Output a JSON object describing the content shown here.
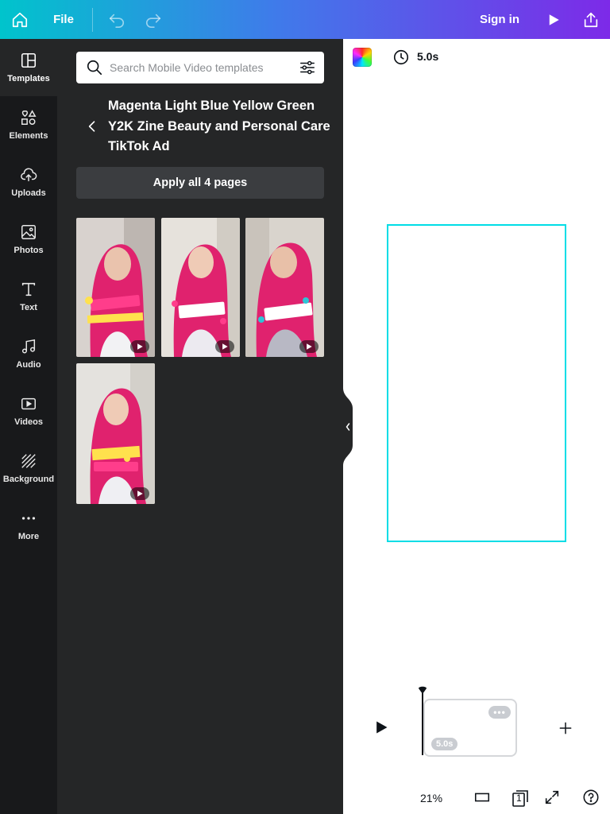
{
  "topbar": {
    "file_label": "File",
    "signin_label": "Sign in",
    "icons": [
      "home-icon",
      "undo-icon",
      "redo-icon",
      "play-icon",
      "share-icon"
    ]
  },
  "rail": {
    "items": [
      {
        "label": "Templates",
        "icon": "templates-icon"
      },
      {
        "label": "Elements",
        "icon": "elements-icon"
      },
      {
        "label": "Uploads",
        "icon": "upload-cloud-icon"
      },
      {
        "label": "Photos",
        "icon": "photo-icon"
      },
      {
        "label": "Text",
        "icon": "text-icon"
      },
      {
        "label": "Audio",
        "icon": "music-note-icon"
      },
      {
        "label": "Videos",
        "icon": "video-icon"
      },
      {
        "label": "Background",
        "icon": "background-hatch-icon"
      },
      {
        "label": "More",
        "icon": "more-dots-icon"
      }
    ]
  },
  "panel": {
    "search": {
      "placeholder": "Search Mobile Video templates",
      "value": ""
    },
    "template_title": "Magenta Light Blue Yellow Green Y2K Zine Beauty and Personal Care TikTok Ad",
    "apply_label": "Apply all 4 pages",
    "pages": [
      {
        "name": "page-1"
      },
      {
        "name": "page-2"
      },
      {
        "name": "page-3"
      },
      {
        "name": "page-4"
      }
    ]
  },
  "editor": {
    "duration_label": "5.0s",
    "clip_duration": "5.0s",
    "clip_more": "•••",
    "zoom": "21%",
    "page_count": "1"
  },
  "colors": {
    "accent_cyan": "#00c4cc",
    "accent_purple": "#7d2ae8",
    "rail_bg": "#18191b",
    "panel_bg": "#252627",
    "frame_border": "#00dde6"
  }
}
